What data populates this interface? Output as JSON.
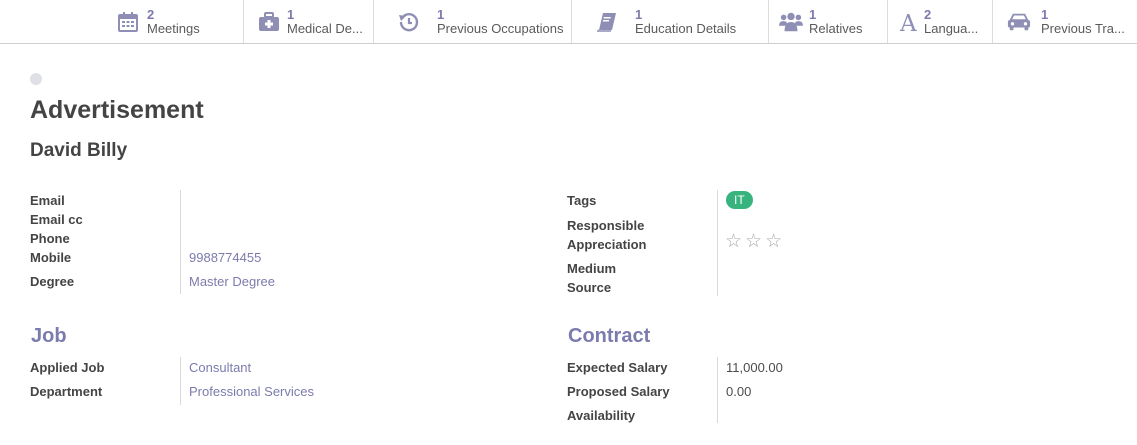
{
  "smart_buttons": [
    {
      "icon": "calendar-icon",
      "value": "2",
      "label": "Meetings"
    },
    {
      "icon": "medical-kit-icon",
      "value": "1",
      "label": "Medical De..."
    },
    {
      "icon": "history-icon",
      "value": "1",
      "label": "Previous Occupations"
    },
    {
      "icon": "book-icon",
      "value": "1",
      "label": "Education Details"
    },
    {
      "icon": "users-icon",
      "value": "1",
      "label": "Relatives"
    },
    {
      "icon": "font-icon",
      "value": "2",
      "label": "Langua..."
    },
    {
      "icon": "car-icon",
      "value": "1",
      "label": "Previous Tra..."
    }
  ],
  "record": {
    "title": "Advertisement",
    "name": "David Billy"
  },
  "left_fields": {
    "email_label": "Email",
    "email_cc_label": "Email cc",
    "phone_label": "Phone",
    "mobile_label": "Mobile",
    "mobile_value": "9988774455",
    "degree_label": "Degree",
    "degree_value": "Master Degree"
  },
  "right_fields": {
    "tags_label": "Tags",
    "tag_value": "IT",
    "responsible_label": "Responsible",
    "appreciation_label": "Appreciation",
    "medium_label": "Medium",
    "source_label": "Source",
    "stars": [
      "☆",
      "☆",
      "☆"
    ]
  },
  "job": {
    "section_title": "Job",
    "applied_job_label": "Applied Job",
    "applied_job_value": "Consultant",
    "department_label": "Department",
    "department_value": "Professional Services"
  },
  "contract": {
    "section_title": "Contract",
    "expected_salary_label": "Expected Salary",
    "expected_salary_value": "11,000.00",
    "proposed_salary_label": "Proposed Salary",
    "proposed_salary_value": "0.00",
    "availability_label": "Availability"
  },
  "colors": {
    "accent": "#7c7bad",
    "tag_green": "#37b37e",
    "text": "#444444"
  }
}
